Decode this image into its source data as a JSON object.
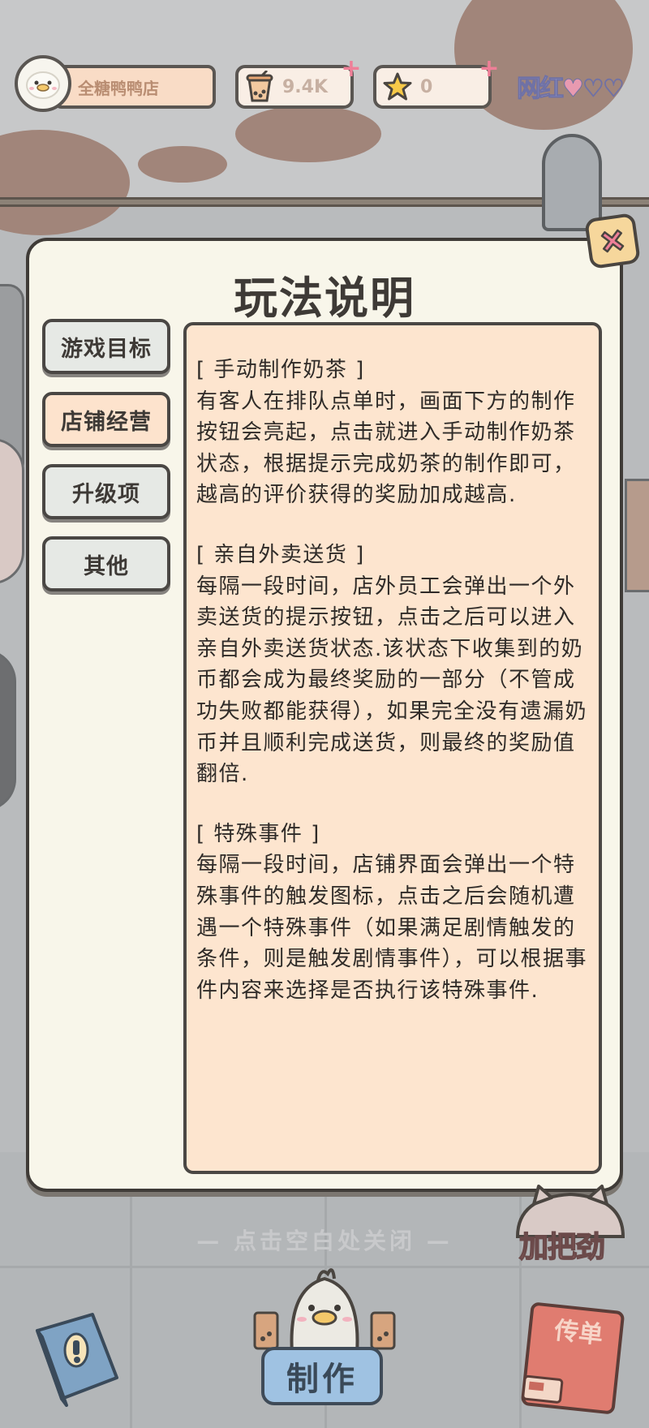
{
  "hud": {
    "shop_name": "全糖鸭鸭店",
    "currency": "9.4K",
    "stars": "0",
    "fame_label": "网红",
    "plus_symbol": "+"
  },
  "dialog": {
    "title": "玩法说明",
    "tabs": [
      {
        "label": "游戏目标",
        "active": false
      },
      {
        "label": "店铺经营",
        "active": true
      },
      {
        "label": "升级项",
        "active": false
      },
      {
        "label": "其他",
        "active": false
      }
    ],
    "sections": [
      {
        "heading": "[ 手动制作奶茶 ]",
        "body": "有客人在排队点单时，画面下方的制作按钮会亮起，点击就进入手动制作奶茶状态，根据提示完成奶茶的制作即可，越高的评价获得的奖励加成越高."
      },
      {
        "heading": "[ 亲自外卖送货 ]",
        "body": "每隔一段时间，店外员工会弹出一个外卖送货的提示按钮，点击之后可以进入亲自外卖送货状态.该状态下收集到的奶币都会成为最终奖励的一部分（不管成功失败都能获得），如果完全没有遗漏奶币并且顺利完成送货，则最终的奖励值翻倍."
      },
      {
        "heading": "[ 特殊事件 ]",
        "body": "每隔一段时间，店铺界面会弹出一个特殊事件的触发图标，点击之后会随机遭遇一个特殊事件（如果满足剧情触发的条件，则是触发剧情事件），可以根据事件内容来选择是否执行该特殊事件."
      }
    ]
  },
  "hint": "— 点击空白处关闭 —",
  "bottom": {
    "make_label": "制作",
    "flyer_label": "传单",
    "cheer_label": "加把劲"
  },
  "colors": {
    "dialog_bg": "#f8f6ea",
    "content_bg": "#fde5cf",
    "active_tab": "#fde3cd",
    "inactive_tab": "#e6e9e5",
    "close_bg": "#f6d79c",
    "close_x": "#ef7f98",
    "make_btn": "#9fc2e2"
  },
  "icons": [
    "duck-avatar-icon",
    "milk-tea-icon",
    "star-icon",
    "heart-icon",
    "close-icon",
    "book-icon",
    "duck-chef-icon",
    "flyer-icon"
  ]
}
